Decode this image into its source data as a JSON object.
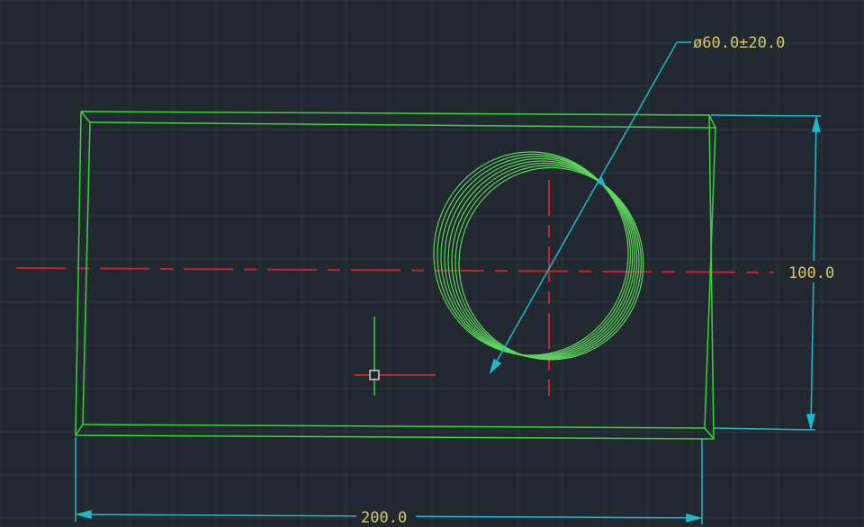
{
  "drawing": {
    "hole_dimension": "ø60.0±20.0",
    "height_dimension": "100.0",
    "width_dimension": "200.0"
  },
  "colors": {
    "background": "#212830",
    "grid": "#2c333b",
    "part_outline": "#35d635",
    "hole": "#5cd65c",
    "centerline": "#c4232b",
    "dimension": "#1fb8cc",
    "dimension_text": "#d8c86a",
    "cursor": "#e6e6e6"
  }
}
